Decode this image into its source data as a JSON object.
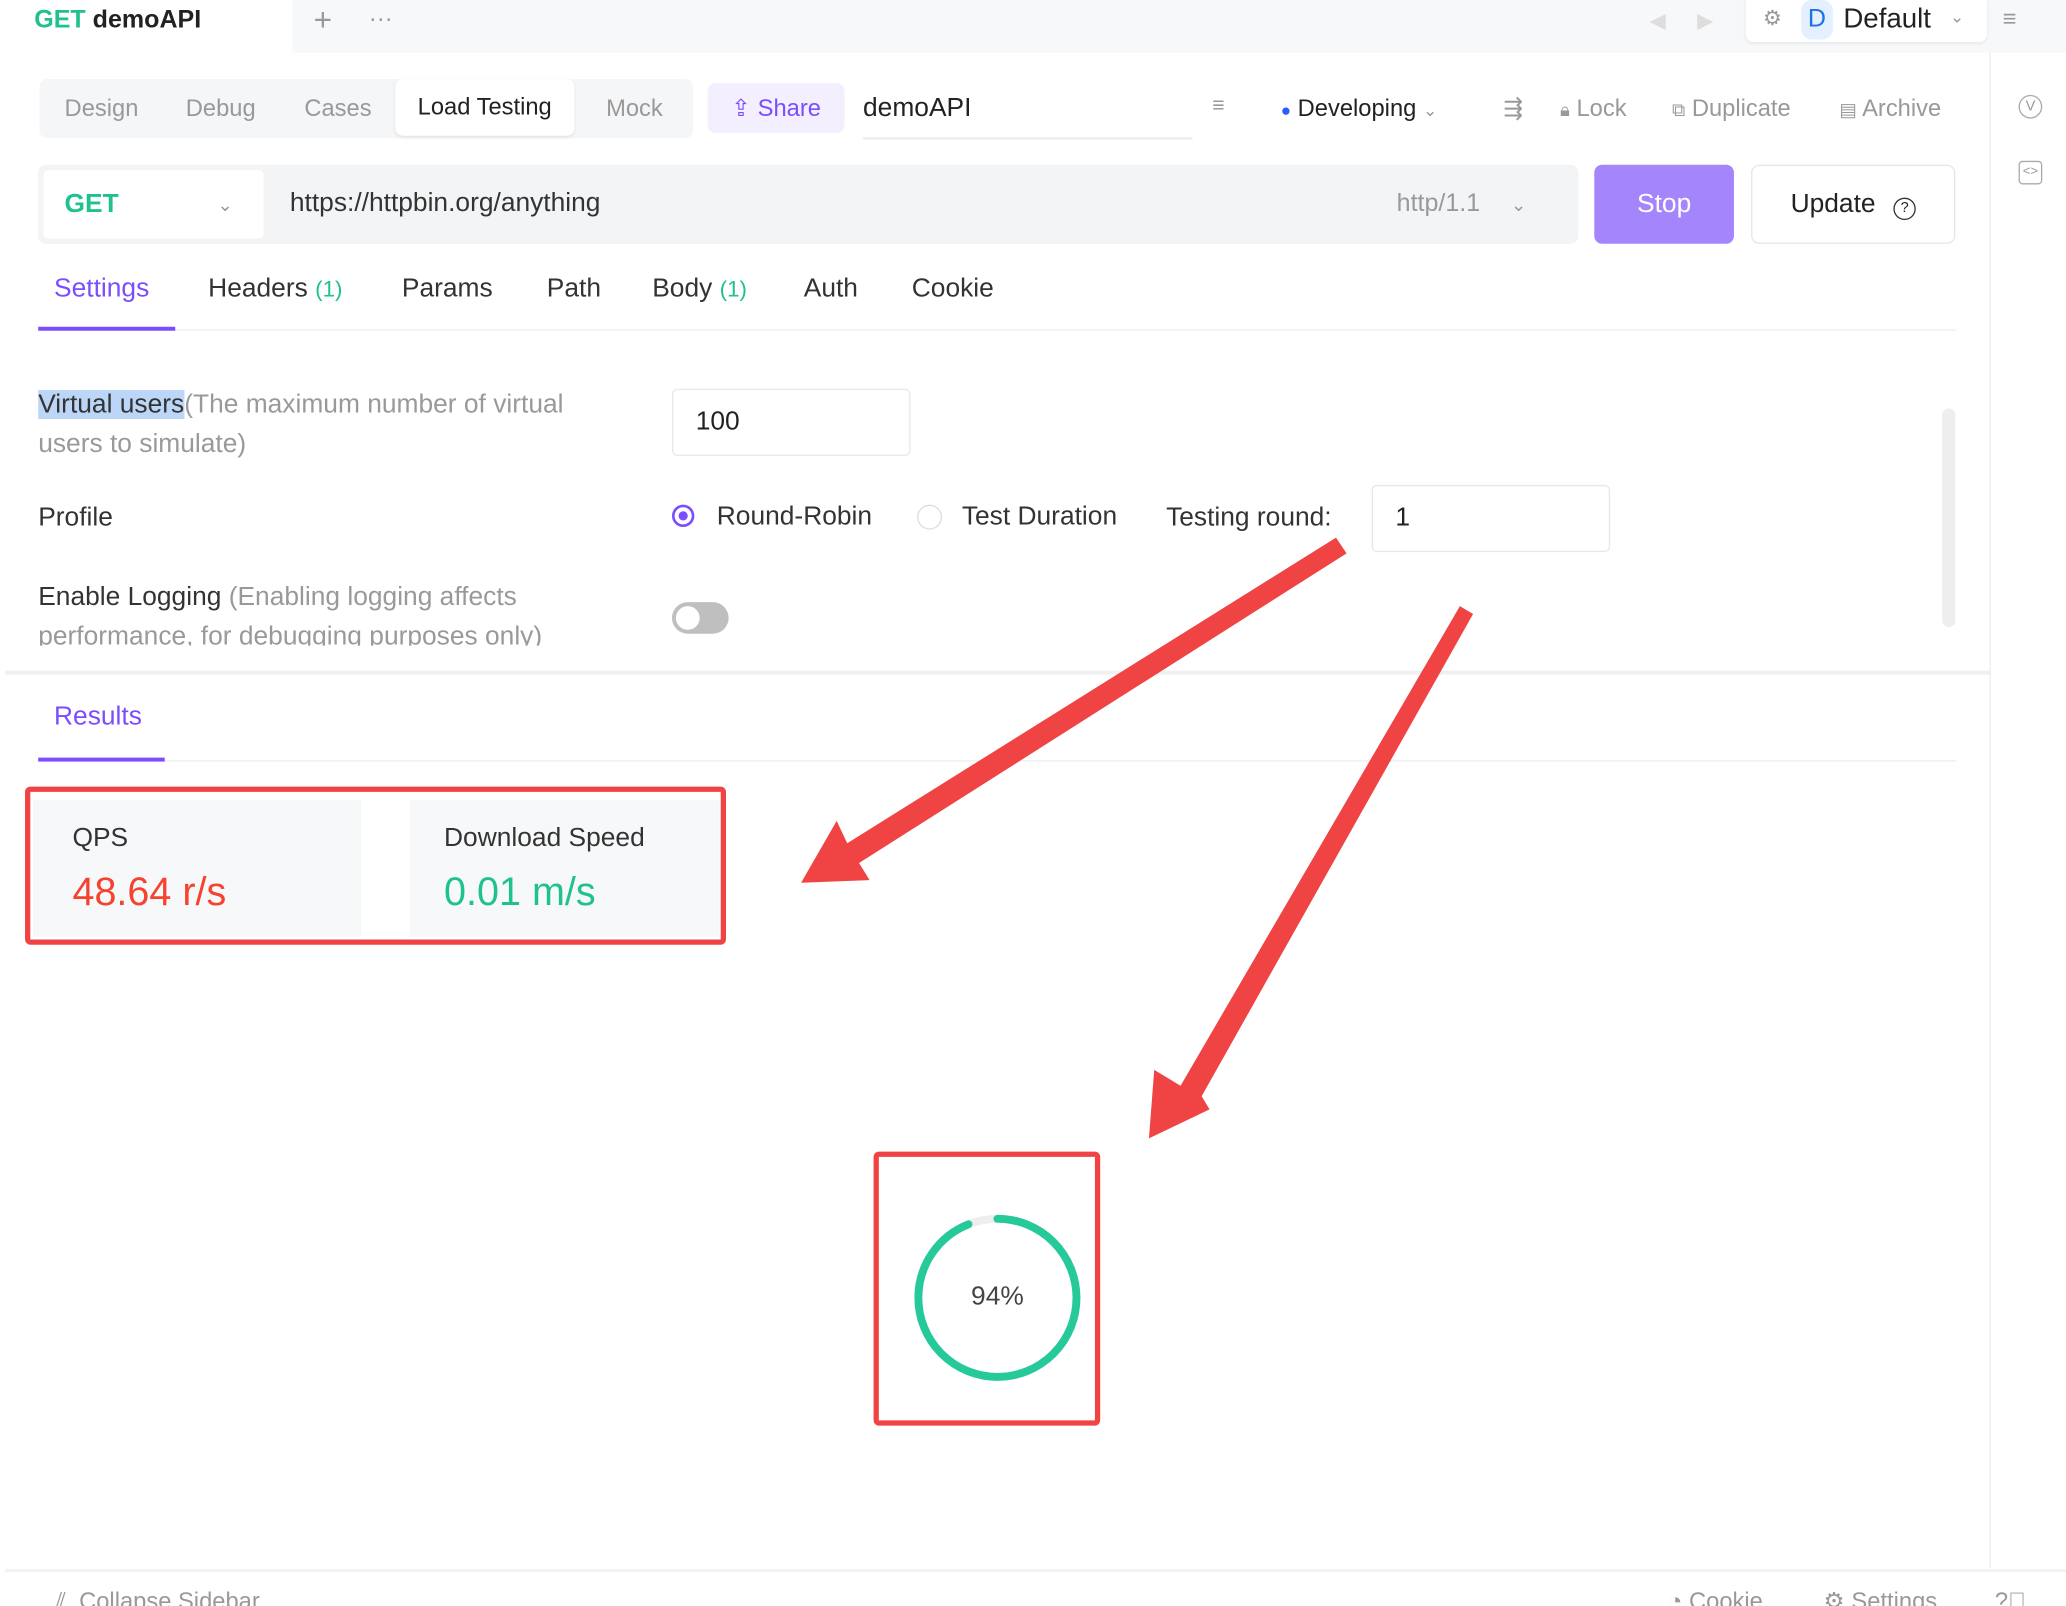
{
  "window": {
    "method": "GET",
    "title": "demoAPI",
    "env": "Default",
    "env_badge": "D"
  },
  "modes": [
    "Design",
    "Debug",
    "Cases",
    "Load Testing",
    "Mock"
  ],
  "active_mode": "Load Testing",
  "share_label": "Share",
  "api_name": "demoAPI",
  "status": {
    "label": "Developing",
    "color": "#2a5cff"
  },
  "actions": {
    "lock": "Lock",
    "duplicate": "Duplicate",
    "archive": "Archive"
  },
  "request": {
    "method": "GET",
    "url": "https://httpbin.org/anything",
    "protocol": "http/1.1"
  },
  "buttons": {
    "stop": "Stop",
    "update": "Update"
  },
  "tabs": [
    {
      "label": "Settings"
    },
    {
      "label": "Headers",
      "count": "(1)"
    },
    {
      "label": "Params"
    },
    {
      "label": "Path"
    },
    {
      "label": "Body",
      "count": "(1)"
    },
    {
      "label": "Auth"
    },
    {
      "label": "Cookie"
    }
  ],
  "settings": {
    "virtual_users_label": "Virtual users",
    "virtual_users_hint": "(The maximum number of virtual users to simulate)",
    "virtual_users": "100",
    "profile_label": "Profile",
    "profile_options": [
      "Round-Robin",
      "Test Duration"
    ],
    "profile_selected": "Round-Robin",
    "testing_round_label": "Testing round:",
    "testing_round": "1",
    "logging_label": "Enable Logging",
    "logging_hint": "(Enabling logging affects performance, for debugging purposes only)",
    "logging_enabled": false
  },
  "results": {
    "tab": "Results",
    "qps_label": "QPS",
    "qps": "48.64 r/s",
    "qps_color": "#f5432f",
    "download_label": "Download Speed",
    "download": "0.01 m/s",
    "download_color": "#1fc28e",
    "progress": 94,
    "progress_text": "94%",
    "progress_color": "#26c99a"
  },
  "footer": {
    "collapse": "Collapse Sidebar",
    "cookie": "Cookie",
    "settings": "Settings"
  }
}
